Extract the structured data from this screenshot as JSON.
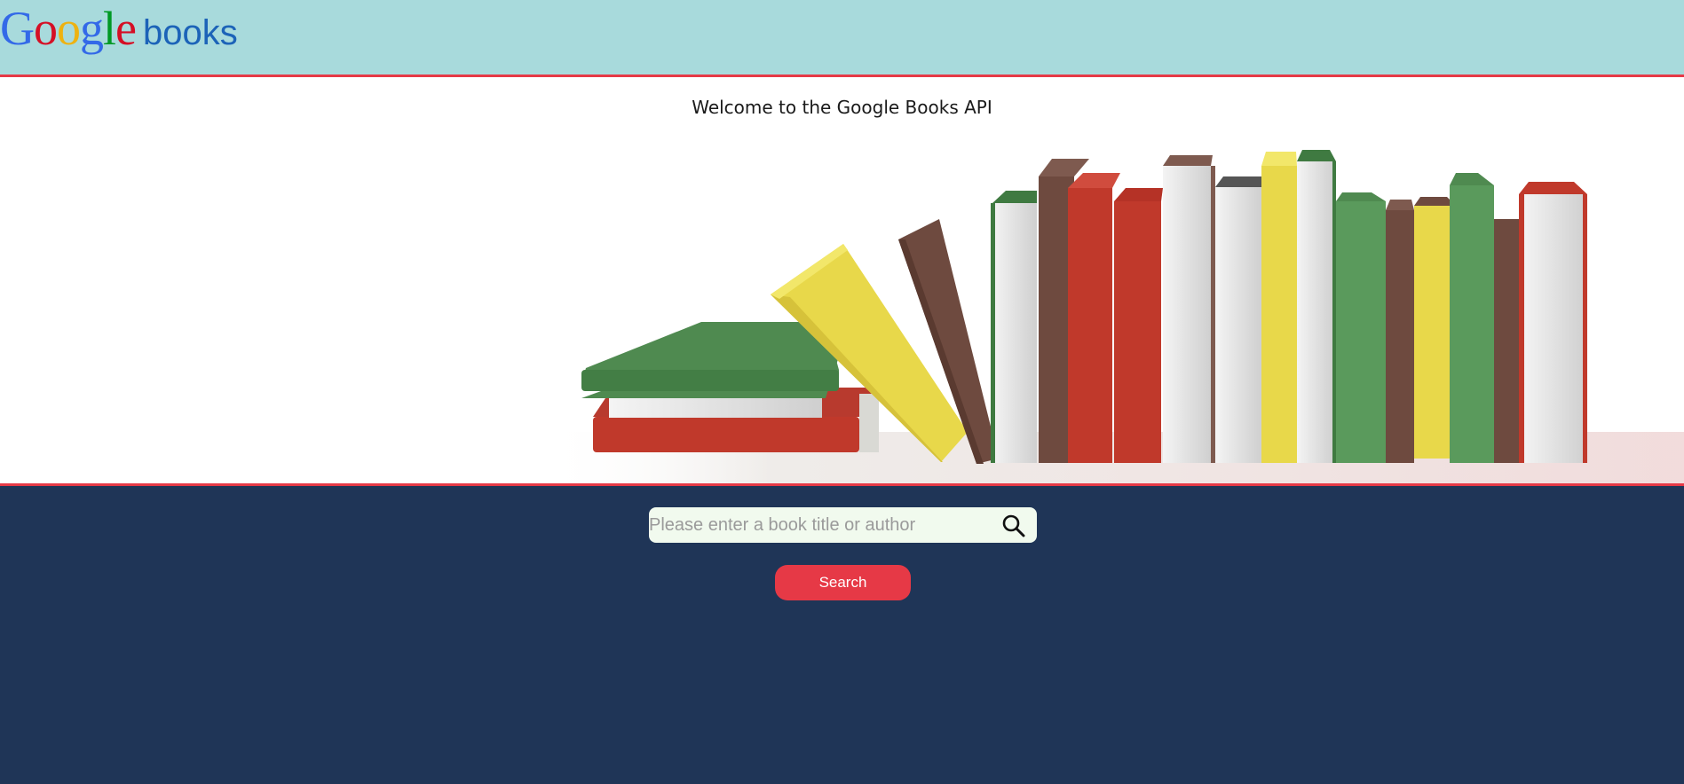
{
  "header": {
    "logo_letters": [
      "G",
      "o",
      "o",
      "g",
      "l",
      "e"
    ],
    "logo_suffix": "books"
  },
  "hero": {
    "welcome_text": "Welcome to the Google Books API",
    "image_name": "books-illustration"
  },
  "search": {
    "placeholder": "Please enter a book title or author",
    "value": "",
    "button_label": "Search",
    "icon": "search-icon"
  },
  "colors": {
    "header_bg": "#a8dadc",
    "accent_red": "#e63946",
    "page_bg": "#1f3557",
    "input_bg": "#f1faee"
  }
}
